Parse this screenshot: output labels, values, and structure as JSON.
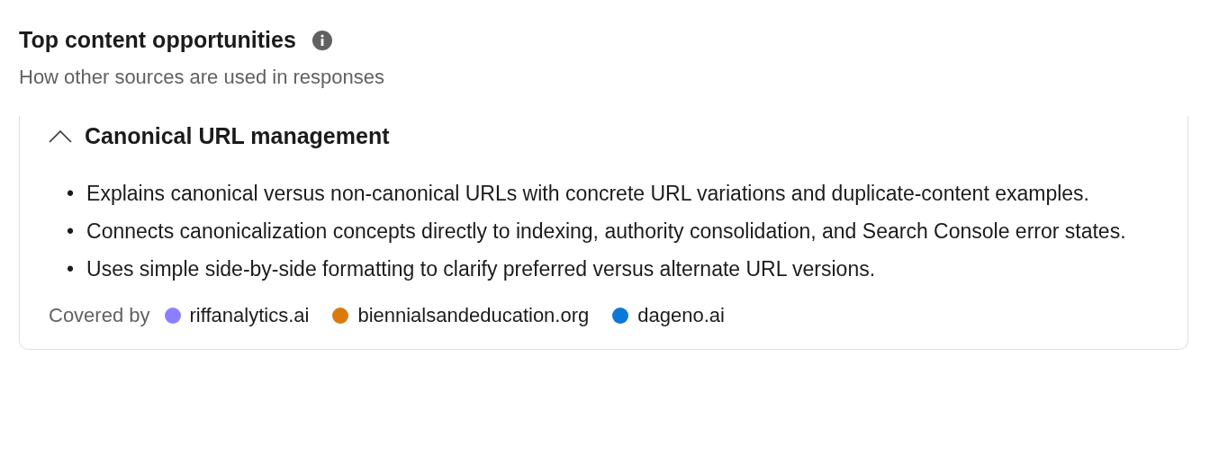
{
  "header": {
    "title": "Top content opportunities",
    "subtitle": "How other sources are used in responses"
  },
  "opportunity": {
    "title": "Canonical URL management",
    "expanded": true,
    "bullet": "•",
    "points": [
      "Explains canonical versus non-canonical URLs with concrete URL variations and duplicate-content examples.",
      "Connects canonicalization concepts directly to indexing, authority consolidation, and Search Console error states.",
      "Uses simple side-by-side formatting to clarify preferred versus alternate URL versions."
    ],
    "covered_by_label": "Covered by",
    "sources": [
      {
        "name": "riffanalytics.ai",
        "color": "#8a80ff"
      },
      {
        "name": "biennialsandeducation.org",
        "color": "#db7a0c"
      },
      {
        "name": "dageno.ai",
        "color": "#0a78d7"
      }
    ]
  }
}
